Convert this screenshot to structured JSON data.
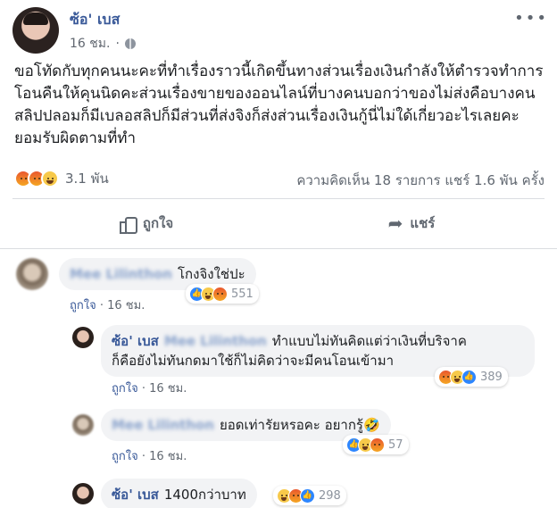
{
  "post": {
    "author": "ซ้อ' เบส",
    "time": "16 ชม.",
    "more_icon": "more-icon",
    "text": "ขอโทัดกับทุกคนนะคะที่ทำเรื่องราวนี้เกิดขึ้นทางส่วนเรื่องเงินกำลังให้ตำรวจทำการโอนคืนให้คุนนิดคะส่วนเรื่องขายของออนไลน์ที่บางคนบอกว่าของไม่ส่งคือบางคนสลิปปลอมก็มีเบลอสลิปก็มีส่วนที่ส่งจิงก็ส่งส่วนเรื่องเงินกู้นี่ไม่ใด้เกี่ยวอะไรเลยคะยอมรับผิดตามที่ทำ",
    "reaction_count": "3.1 พัน",
    "stats": "ความคิดเห็น 18 รายการ  แชร์ 1.6 พัน ครั้ง",
    "like_label": "ถูกใจ",
    "share_label": "แชร์"
  },
  "comments": [
    {
      "name": "Mee Lilinthon",
      "text": "โกงจิงใช่ปะ",
      "like_link": "ถูกใจ",
      "time": "16 ชม.",
      "react_count": "551"
    },
    {
      "name": "ซ้อ' เบส",
      "tagged": "Mee Lilinthon",
      "text_line1": "ทำแบบไม่ทันคิดแต่ว่าเงินที่บริจาค",
      "text_line2": "ก็คือยังไม่ทันกดมาใช้ก็ไม่คิดว่าจะมีคนโอนเข้ามา",
      "like_link": "ถูกใจ",
      "time": "16 ชม.",
      "react_count": "389"
    },
    {
      "name": "Mee Lilinthon",
      "text": "ยอดเท่ารัยหรอคะ อยากรู้🤣",
      "like_link": "ถูกใจ",
      "time": "16 ชม.",
      "react_count": "57"
    },
    {
      "name": "ซ้อ' เบส",
      "text": "1400กว่าบาท",
      "react_count": "298"
    }
  ],
  "colors": {
    "link": "#385898",
    "muted": "#606770",
    "bubble": "#f2f3f5"
  }
}
